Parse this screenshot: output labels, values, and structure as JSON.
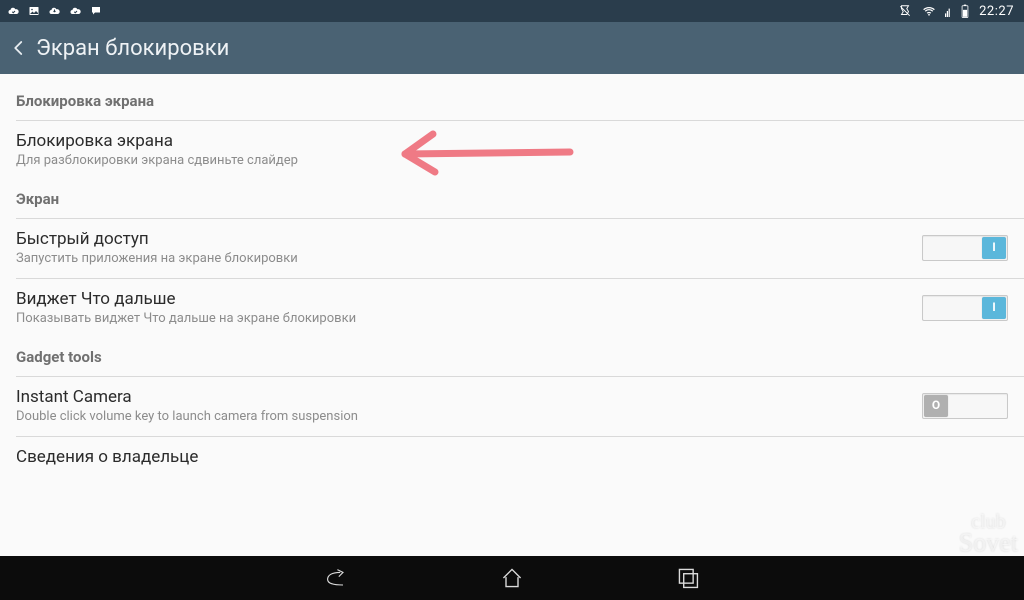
{
  "status": {
    "time": "22:27",
    "icons_left": [
      "cloud-check",
      "image",
      "cloud-down",
      "cloud-check",
      "speech"
    ],
    "icons_right": [
      "vibrate",
      "wifi",
      "signal",
      "battery"
    ]
  },
  "titlebar": {
    "label": "Экран блокировки"
  },
  "sections": [
    {
      "header": "Блокировка экрана",
      "items": [
        {
          "id": "screen-lock",
          "title": "Блокировка экрана",
          "subtitle": "Для разблокировки экрана сдвиньте слайдер",
          "toggle": null
        }
      ]
    },
    {
      "header": "Экран",
      "items": [
        {
          "id": "quick-access",
          "title": "Быстрый доступ",
          "subtitle": "Запустить приложения на экране блокировки",
          "toggle": {
            "state": "on",
            "label": "I"
          }
        },
        {
          "id": "whats-next-widget",
          "title": "Виджет Что дальше",
          "subtitle": "Показывать виджет Что дальше на экране блокировки",
          "toggle": {
            "state": "on",
            "label": "I"
          }
        }
      ]
    },
    {
      "header": "Gadget tools",
      "items": [
        {
          "id": "instant-camera",
          "title": "Instant Camera",
          "subtitle": "Double click volume key to launch camera from suspension",
          "toggle": {
            "state": "off",
            "label": "O"
          }
        },
        {
          "id": "owner-info",
          "title": "Сведения о владельце",
          "subtitle": "",
          "toggle": null
        }
      ]
    }
  ],
  "watermark": {
    "line1": "club",
    "line2": "Sovet"
  },
  "colors": {
    "statusbar": "#2a3d4c",
    "titlebar": "#4a6273",
    "toggle_on": "#5bb7db",
    "toggle_off": "#b0b0b0",
    "arrow": "#ef7a85"
  }
}
